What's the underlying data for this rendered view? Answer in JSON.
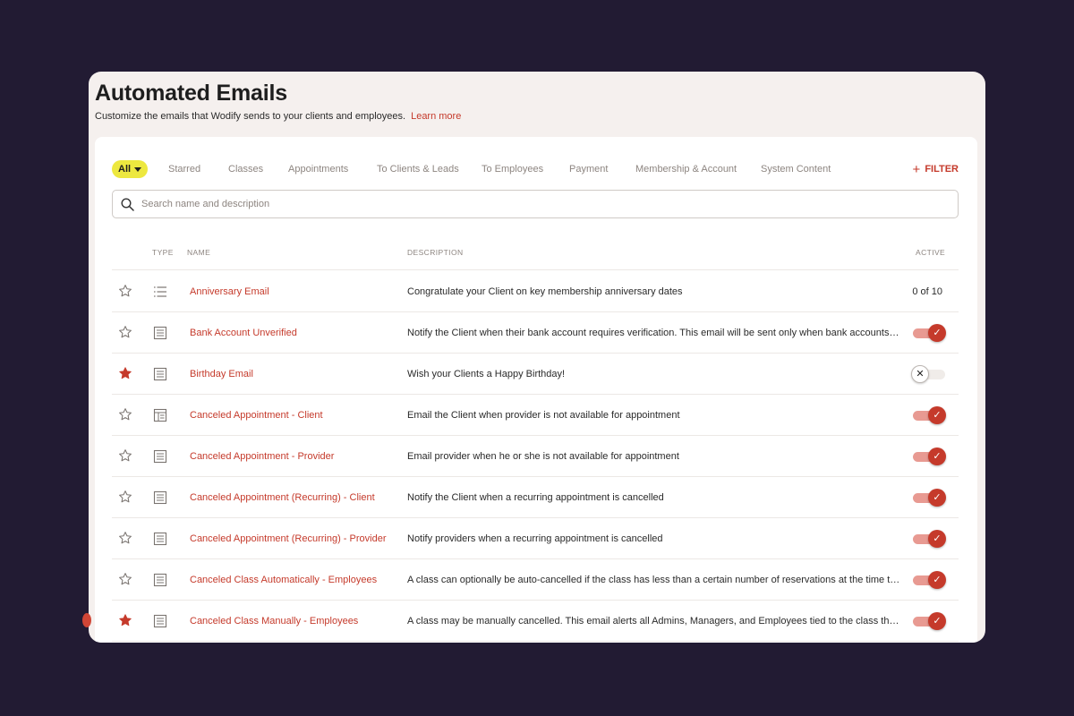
{
  "page": {
    "title": "Automated Emails",
    "subtitle": "Customize the emails that Wodify sends to your clients and employees.",
    "learn_more": "Learn more"
  },
  "tabs": {
    "all": "All",
    "items": [
      "Starred",
      "Classes",
      "Appointments",
      "To Clients & Leads",
      "To Employees",
      "Payment",
      "Membership & Account",
      "System Content"
    ],
    "filter": "FILTER"
  },
  "search": {
    "placeholder": "Search name and description"
  },
  "table": {
    "headers": {
      "type": "TYPE",
      "name": "NAME",
      "description": "DESCRIPTION",
      "active": "ACTIVE"
    },
    "rows": [
      {
        "starred": false,
        "type_icon": "list-icon",
        "name": "Anniversary Email",
        "description": "Congratulate your Client on key membership anniversary dates",
        "active_text": "0 of 10",
        "active": null
      },
      {
        "starred": false,
        "type_icon": "document-icon",
        "name": "Bank Account Unverified",
        "description": "Notify the Client when their bank account requires verification. This email will be sent only when bank accounts are…",
        "active_text": "",
        "active": true
      },
      {
        "starred": true,
        "type_icon": "document-icon",
        "name": "Birthday Email",
        "description": "Wish your Clients a Happy Birthday!",
        "active_text": "",
        "active": false
      },
      {
        "starred": false,
        "type_icon": "layout-icon",
        "name": "Canceled Appointment - Client",
        "description": "Email the Client when provider is not available for appointment",
        "active_text": "",
        "active": true
      },
      {
        "starred": false,
        "type_icon": "document-icon",
        "name": "Canceled Appointment - Provider",
        "description": "Email provider when he or she is not available for appointment",
        "active_text": "",
        "active": true
      },
      {
        "starred": false,
        "type_icon": "document-icon",
        "name": "Canceled Appointment (Recurring) - Client",
        "description": "Notify the Client when a recurring appointment is cancelled",
        "active_text": "",
        "active": true
      },
      {
        "starred": false,
        "type_icon": "document-icon",
        "name": "Canceled Appointment (Recurring) - Provider",
        "description": "Notify providers when a recurring appointment is cancelled",
        "active_text": "",
        "active": true
      },
      {
        "starred": false,
        "type_icon": "document-icon",
        "name": "Canceled Class Automatically - Employees",
        "description": "A class can optionally be auto-cancelled if the class has less than a certain number of reservations at the time the …",
        "active_text": "",
        "active": true
      },
      {
        "starred": true,
        "type_icon": "document-icon",
        "name": "Canceled Class Manually - Employees",
        "description": "A class may be manually cancelled. This email alerts all Admins, Managers, and Employees tied to the class that the…",
        "active_text": "",
        "active": true
      }
    ]
  },
  "colors": {
    "accent": "#c53a2b",
    "all_tab": "#ede83f",
    "background": "#221b33",
    "window": "#f5f0ee"
  }
}
